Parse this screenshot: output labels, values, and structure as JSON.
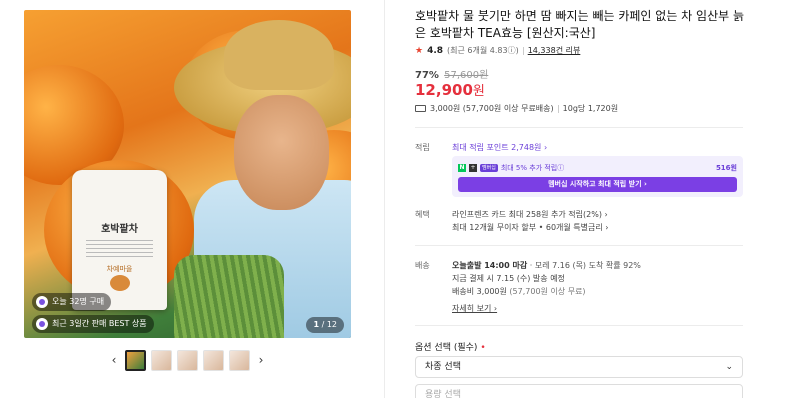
{
  "gallery": {
    "pouch_title": "호박팥차",
    "pouch_brand": "차예마을",
    "badge_buy": "오늘 32명 구매",
    "badge_best": "최근 3일간 판매 BEST 상품",
    "counter_current": "1",
    "counter_total": "/ 12",
    "prev_arrow": "‹",
    "next_arrow": "›"
  },
  "product": {
    "title": "호박팥차 물 붓기만 하면 땀 빠지는 빼는 카페인 없는 차 임산부 늙은 호박팥차 TEA효능 [원산지:국산]",
    "rating": "4.8",
    "rating_sub": "(최근 6개월 4.83ⓘ)",
    "reviews": "14,338건 리뷰",
    "discount_pct": "77%",
    "original_price": "57,600원",
    "price": "12,900",
    "price_unit": "원",
    "shipping_fee": "3,000원 (57,700원 이상 무료배송)",
    "unit_price": "10g당 1,720원"
  },
  "points": {
    "label": "적립",
    "max_points": "최대 적립 포인트 2,748원 ›",
    "npay_logo": "N",
    "npay_plus": "+",
    "npay_tag": "멤버십",
    "npay_text": "최대 5% 추가 적립ⓘ",
    "npay_amount": "516원",
    "npay_button": "멤버십 시작하고 최대 적립 받기 ›"
  },
  "benefit": {
    "label": "혜택",
    "line1": "라인프렌즈 카드 최대 258원 추가 적립(2%) ›",
    "line2": "최대 12개월 무이자 할부 • 60개월 특별금리 ›"
  },
  "delivery": {
    "label": "배송",
    "today": "오늘출발 14:00 마감",
    "arrival": " · 모레 7.16 (목) 도착 확률 92%",
    "pay_now": "지금 결제 시 7.15 (수) 발송 예정",
    "fee_label": "배송비 3,000원",
    "fee_sub": " (57,700원 이상 무료)",
    "more": "자세히 보기 ›"
  },
  "options": {
    "title": "옵션 선택 (필수)",
    "required_mark": "•",
    "select1": "차종 선택",
    "select2": "용량 선택",
    "chevron": "⌄"
  }
}
